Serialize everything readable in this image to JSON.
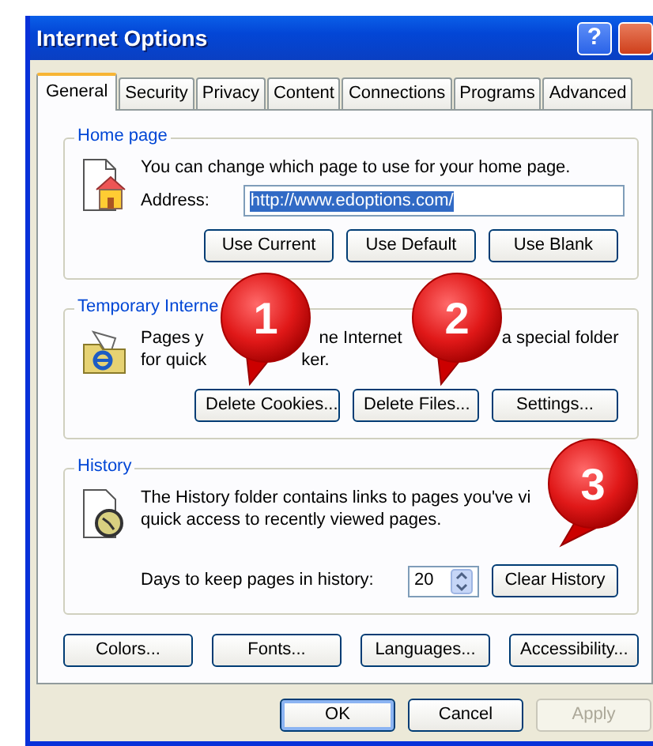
{
  "window": {
    "title": "Internet Options",
    "help_button": "?"
  },
  "tabs": [
    {
      "label": "General",
      "selected": true
    },
    {
      "label": "Security",
      "selected": false
    },
    {
      "label": "Privacy",
      "selected": false
    },
    {
      "label": "Content",
      "selected": false
    },
    {
      "label": "Connections",
      "selected": false
    },
    {
      "label": "Programs",
      "selected": false
    },
    {
      "label": "Advanced",
      "selected": false
    }
  ],
  "home_page": {
    "legend": "Home page",
    "description": "You can change which page to use for your home page.",
    "address_label": "Address:",
    "address_value": "http://www.edoptions.com/",
    "address_value_selected": true,
    "buttons": [
      "Use Current",
      "Use Default",
      "Use Blank"
    ]
  },
  "temporary_files": {
    "legend": "Temporary Interne",
    "description_lines": [
      [
        "Pages y",
        "ne Internet",
        "a special folder"
      ],
      [
        "for quick",
        "ker."
      ]
    ],
    "buttons": [
      "Delete Cookies...",
      "Delete Files...",
      "Settings..."
    ]
  },
  "history": {
    "legend": "History",
    "description_lines": [
      "The History folder contains links to pages you've vi",
      "quick access to recently viewed pages."
    ],
    "days_label": "Days to keep pages in history:",
    "days_value": "20",
    "button": "Clear History"
  },
  "bottom_buttons": [
    "Colors...",
    "Fonts...",
    "Languages...",
    "Accessibility..."
  ],
  "dialog_buttons": [
    {
      "label": "OK",
      "default": true,
      "disabled": false
    },
    {
      "label": "Cancel",
      "default": false,
      "disabled": false
    },
    {
      "label": "Apply",
      "default": false,
      "disabled": true
    }
  ],
  "callouts": [
    {
      "label": "1"
    },
    {
      "label": "2"
    },
    {
      "label": "3"
    }
  ]
}
